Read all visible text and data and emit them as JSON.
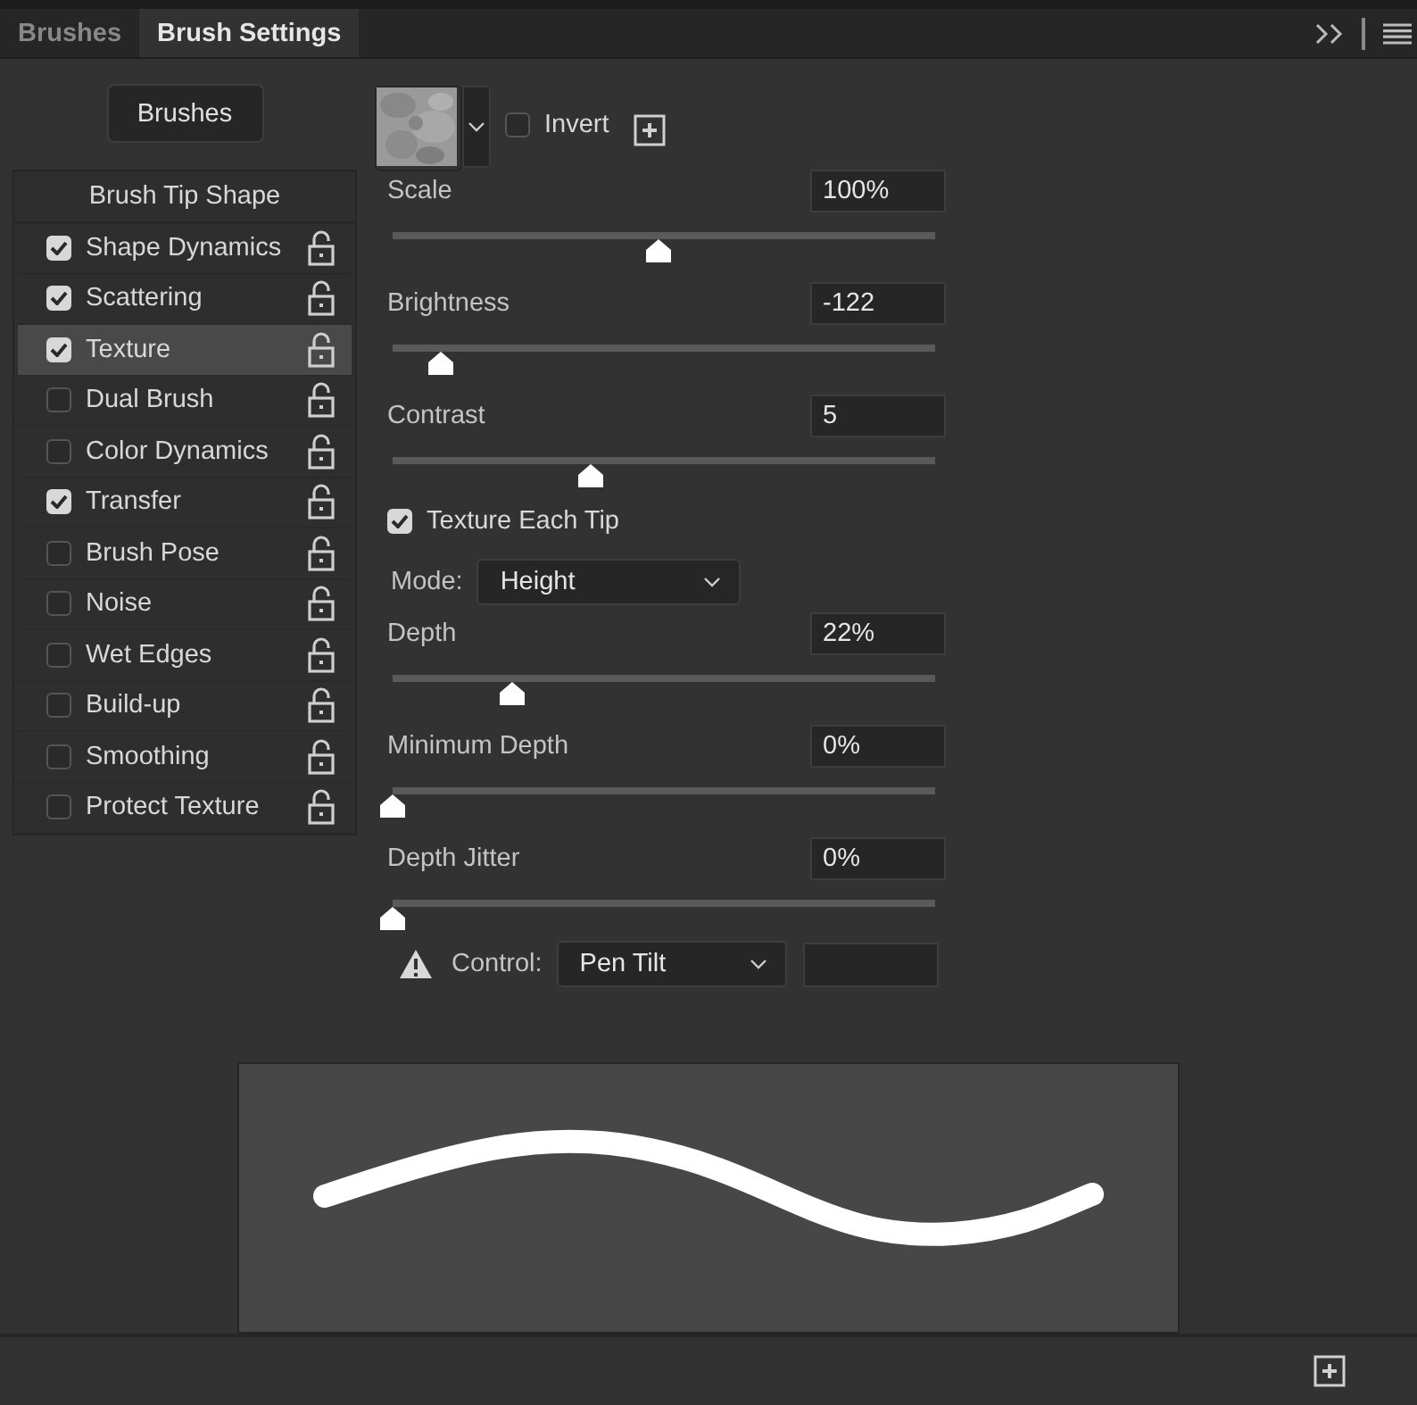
{
  "tabs": [
    {
      "label": "Brushes",
      "selected": false
    },
    {
      "label": "Brush Settings",
      "selected": true
    }
  ],
  "brushes_button": "Brushes",
  "tip_shape_item": "Brush Tip Shape",
  "options": [
    {
      "label": "Shape Dynamics",
      "checked": true,
      "selected": false
    },
    {
      "label": "Scattering",
      "checked": true,
      "selected": false
    },
    {
      "label": "Texture",
      "checked": true,
      "selected": true
    },
    {
      "label": "Dual Brush",
      "checked": false,
      "selected": false
    },
    {
      "label": "Color Dynamics",
      "checked": false,
      "selected": false
    },
    {
      "label": "Transfer",
      "checked": true,
      "selected": false
    },
    {
      "label": "Brush Pose",
      "checked": false,
      "selected": false
    },
    {
      "label": "Noise",
      "checked": false,
      "selected": false
    },
    {
      "label": "Wet Edges",
      "checked": false,
      "selected": false
    },
    {
      "label": "Build-up",
      "checked": false,
      "selected": false
    },
    {
      "label": "Smoothing",
      "checked": false,
      "selected": false
    },
    {
      "label": "Protect Texture",
      "checked": false,
      "selected": false
    }
  ],
  "invert": {
    "label": "Invert",
    "checked": false
  },
  "controls": [
    {
      "kind": "slider",
      "label": "Scale",
      "value": "100%",
      "level": 0.49
    },
    {
      "kind": "slider",
      "label": "Brightness",
      "value": "-122",
      "level": 0.09
    },
    {
      "kind": "slider",
      "label": "Contrast",
      "value": "5",
      "level": 0.365
    },
    {
      "kind": "checkbox",
      "label": "Texture Each Tip",
      "checked": true
    },
    {
      "kind": "dropdown",
      "label": "Mode:",
      "value": "Height"
    },
    {
      "kind": "slider",
      "label": "Depth",
      "value": "22%",
      "level": 0.22
    },
    {
      "kind": "slider",
      "label": "Minimum Depth",
      "value": "0%",
      "level": 0
    },
    {
      "kind": "slider",
      "label": "Depth Jitter",
      "value": "0%",
      "level": 0
    },
    {
      "kind": "control",
      "label": "Control:",
      "value": "Pen Tilt"
    }
  ]
}
